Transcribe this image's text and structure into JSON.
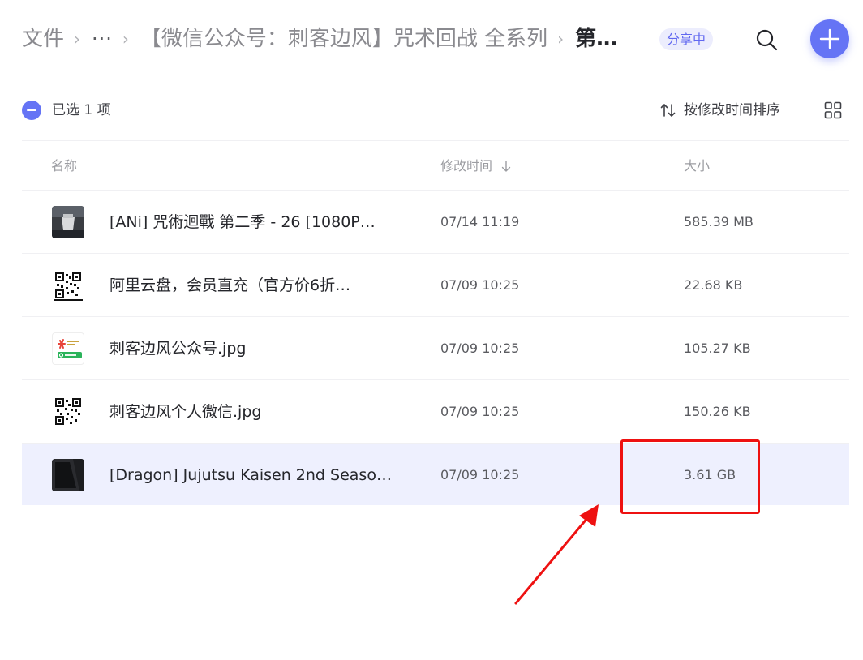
{
  "breadcrumb": {
    "root": "文件",
    "ellipsis": "···",
    "parent": "【微信公众号：刺客边风】咒术回战 全系列",
    "current": "第…",
    "share_badge": "分享中"
  },
  "toolbar": {
    "selected_text": "已选 1 项",
    "sort_label": "按修改时间排序"
  },
  "table": {
    "headers": {
      "name": "名称",
      "time": "修改时间",
      "size": "大小"
    },
    "rows": [
      {
        "name": "[ANi] 咒術迴戰 第二季 - 26 [1080P…",
        "time": "07/14 11:19",
        "size": "585.39 MB",
        "thumb": "video-thumbnail",
        "selected": false
      },
      {
        "name": "阿里云盘，会员直充（官方价6折…",
        "time": "07/09 10:25",
        "size": "22.68 KB",
        "thumb": "qr-code-thumbnail",
        "selected": false
      },
      {
        "name": "刺客边风公众号.jpg",
        "time": "07/09 10:25",
        "size": "105.27 KB",
        "thumb": "wechat-card-thumbnail",
        "selected": false
      },
      {
        "name": "刺客边风个人微信.jpg",
        "time": "07/09 10:25",
        "size": "150.26 KB",
        "thumb": "qr-code-thumbnail",
        "selected": false
      },
      {
        "name": "[Dragon] Jujutsu Kaisen 2nd Seaso…",
        "time": "07/09 10:25",
        "size": "3.61 GB",
        "thumb": "dark-video-thumbnail",
        "selected": true
      }
    ]
  },
  "colors": {
    "accent": "#6574f5",
    "selected_row": "#eef0fe",
    "annotation": "#ee1111"
  }
}
